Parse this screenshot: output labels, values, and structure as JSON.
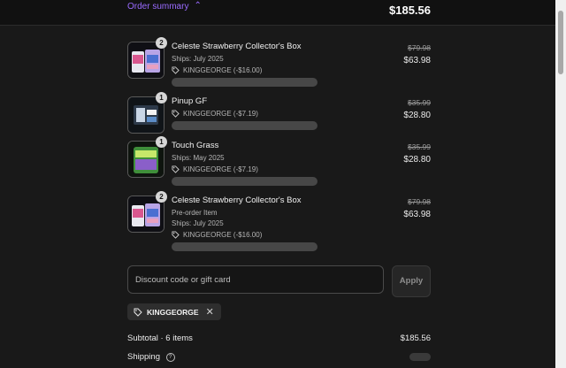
{
  "header": {
    "toggle_label": "Order summary",
    "total": "$185.56"
  },
  "items": [
    {
      "name": "Celeste Strawberry Collector's Box",
      "qty": "2",
      "lines": [
        "Ships: July 2025"
      ],
      "code": "KINGGEORGE (-$16.00)",
      "old_price": "$79.98",
      "new_price": "$63.98"
    },
    {
      "name": "Pinup GF",
      "qty": "1",
      "lines": [],
      "code": "KINGGEORGE (-$7.19)",
      "old_price": "$35.99",
      "new_price": "$28.80"
    },
    {
      "name": "Touch Grass",
      "qty": "1",
      "lines": [
        "Ships: May 2025"
      ],
      "code": "KINGGEORGE (-$7.19)",
      "old_price": "$35.99",
      "new_price": "$28.80"
    },
    {
      "name": "Celeste Strawberry Collector's Box",
      "qty": "2",
      "lines": [
        "Pre-order Item",
        "Ships: July 2025"
      ],
      "code": "KINGGEORGE (-$16.00)",
      "old_price": "$79.98",
      "new_price": "$63.98"
    }
  ],
  "discount": {
    "placeholder": "Discount code or gift card",
    "apply_label": "Apply",
    "applied_code": "KINGGEORGE"
  },
  "totals": {
    "subtotal_label": "Subtotal · 6 items",
    "subtotal_value": "$185.56",
    "shipping_label": "Shipping",
    "shipping_help": "?"
  },
  "icons": {
    "tag": "tag-icon",
    "close": "close-icon",
    "chevron": "chevron-up-icon"
  },
  "colors": {
    "accent": "#9a6bff",
    "background": "#191919"
  }
}
